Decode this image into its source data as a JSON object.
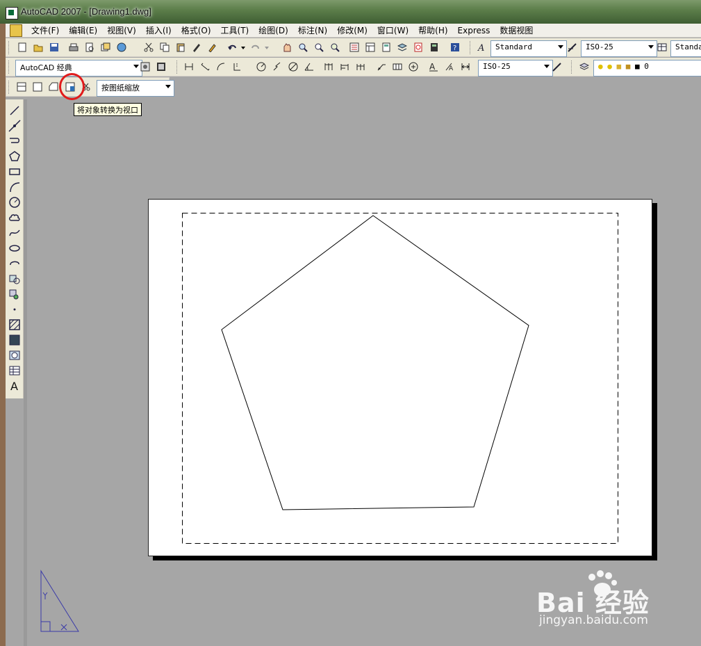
{
  "window": {
    "title": "AutoCAD 2007 - [Drawing1.dwg]"
  },
  "menu": [
    "文件(F)",
    "编辑(E)",
    "视图(V)",
    "插入(I)",
    "格式(O)",
    "工具(T)",
    "绘图(D)",
    "标注(N)",
    "修改(M)",
    "窗口(W)",
    "帮助(H)",
    "Express",
    "数据视图"
  ],
  "toolbar1": {
    "text_style": "Standard",
    "dim_style": "ISO-25",
    "table_style": "Standard"
  },
  "toolbar2": {
    "workspace": "AutoCAD 经典",
    "dim_style": "ISO-25",
    "layer": "0"
  },
  "viewport_toolbar": {
    "scale": "按图纸缩放"
  },
  "tooltip": "将对象转换为视口",
  "colors": {
    "highlight": "#e11b1b",
    "paper": "#ffffff",
    "canvas": "#a6a6a6",
    "ucs": "#3a3aa8"
  },
  "watermark": {
    "brand": "Bai  经验",
    "url": "jingyan.baidu.com"
  }
}
